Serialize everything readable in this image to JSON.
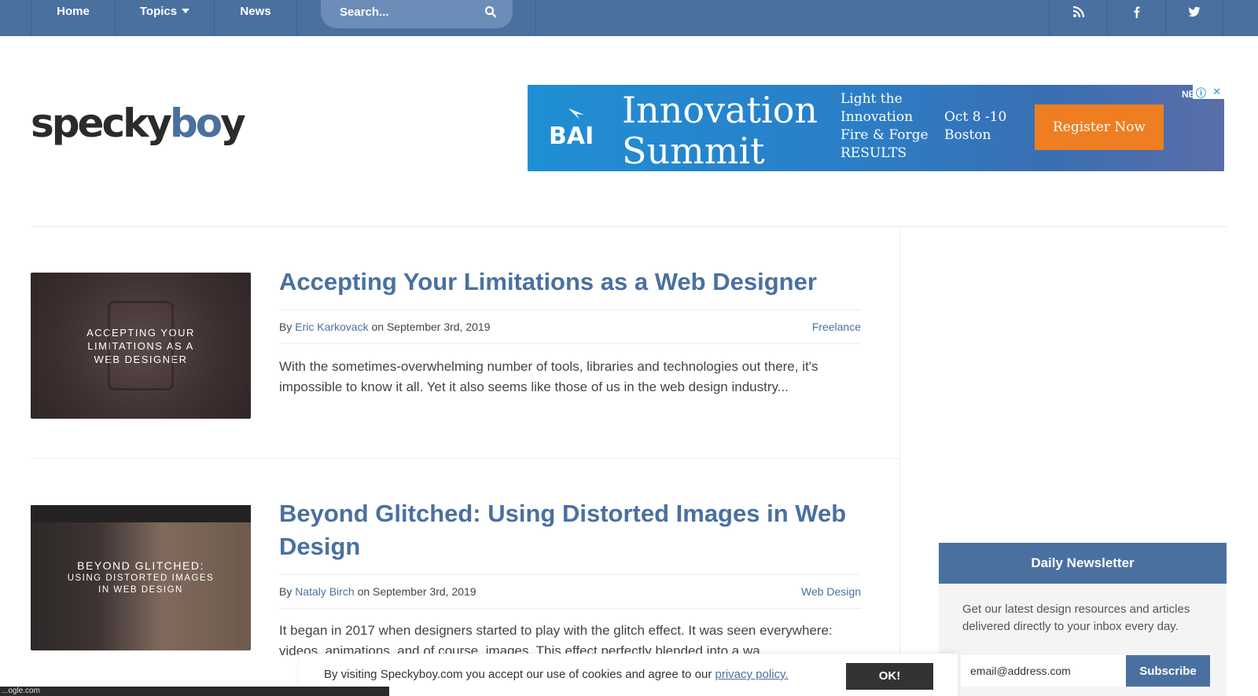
{
  "nav": {
    "home": "Home",
    "topics": "Topics",
    "news": "News",
    "search_placeholder": "Search...",
    "icons": [
      "rss-icon",
      "facebook-icon",
      "twitter-icon"
    ]
  },
  "logo": {
    "part1": "specky",
    "part2": "bo",
    "part3": "y"
  },
  "ad": {
    "brand": "BAI",
    "headline": "Innovation Summit",
    "line1": "Light the",
    "line2": "Innovation",
    "line3": "Fire & Forge",
    "line4": "RESULTS",
    "date": "Oct 8 -10",
    "city": "Boston",
    "cta": "Register Now",
    "tag": "NEW"
  },
  "articles": [
    {
      "thumb_text": [
        "ACCEPTING YOUR",
        "LIMITATIONS AS A",
        "WEB DESIGNER"
      ],
      "title": "Accepting Your Limitations as a Web Designer",
      "by": "By",
      "author": "Eric Karkovack",
      "date": "on September 3rd, 2019",
      "category": "Freelance",
      "excerpt": "With the sometimes-overwhelming number of tools, libraries and technologies out there, it's impossible to know it all. Yet it also seems like those of us in the web design industry..."
    },
    {
      "thumb_text": [
        "BEYOND GLITCHED:",
        "USING DISTORTED IMAGES",
        "IN WEB DESIGN"
      ],
      "title": "Beyond Glitched: Using Distorted Images in Web Design",
      "by": "By",
      "author": "Nataly Birch",
      "date": "on September 3rd, 2019",
      "category": "Web Design",
      "excerpt": "It began in 2017 when designers started to play with the glitch effect. It was seen everywhere: videos, animations, and of course, images. This effect perfectly blended into a wa"
    }
  ],
  "newsletter": {
    "title": "Daily Newsletter",
    "description": "Get our latest design resources and articles delivered directly to your inbox every day.",
    "email_value": "email@address.com",
    "button": "Subscribe"
  },
  "cookie": {
    "text": "By visiting Speckyboy.com you accept our use of cookies and agree to our",
    "link": "privacy policy.",
    "ok": "OK!"
  },
  "statusbar": "...ogle.com"
}
